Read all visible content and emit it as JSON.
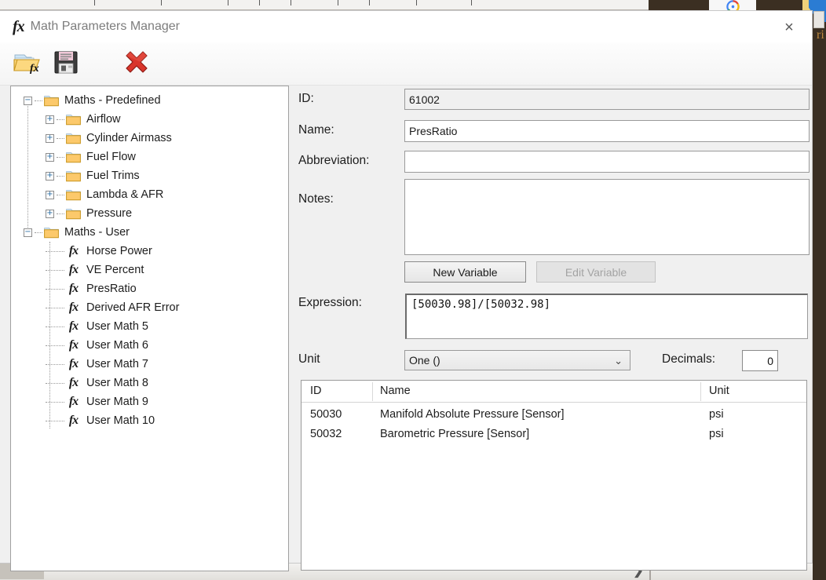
{
  "window": {
    "title": "Math Parameters Manager",
    "fx_icon": "fx-icon",
    "close_icon": "×"
  },
  "toolbar": {
    "buttons": [
      {
        "name": "open-folder-fx-button",
        "icon": "open-folder-fx-icon",
        "label": ""
      },
      {
        "name": "save-button",
        "icon": "floppy-save-icon",
        "label": ""
      },
      {
        "name": "delete-button",
        "icon": "red-x-delete-icon",
        "label": ""
      }
    ]
  },
  "tree": {
    "nodes": [
      {
        "label": "Maths - Predefined",
        "level": 0,
        "type": "folder",
        "expander": "−"
      },
      {
        "label": "Airflow",
        "level": 1,
        "type": "folder",
        "expander": "+"
      },
      {
        "label": "Cylinder Airmass",
        "level": 1,
        "type": "folder",
        "expander": "+"
      },
      {
        "label": "Fuel Flow",
        "level": 1,
        "type": "folder",
        "expander": "+"
      },
      {
        "label": "Fuel Trims",
        "level": 1,
        "type": "folder",
        "expander": "+"
      },
      {
        "label": "Lambda & AFR",
        "level": 1,
        "type": "folder",
        "expander": "+"
      },
      {
        "label": "Pressure",
        "level": 1,
        "type": "folder",
        "expander": "+"
      },
      {
        "label": "Maths - User",
        "level": 0,
        "type": "folder",
        "expander": "−"
      },
      {
        "label": "Horse Power",
        "level": 2,
        "type": "fx",
        "expander": ""
      },
      {
        "label": "VE Percent",
        "level": 2,
        "type": "fx",
        "expander": ""
      },
      {
        "label": "PresRatio",
        "level": 2,
        "type": "fx",
        "expander": ""
      },
      {
        "label": "Derived AFR Error",
        "level": 2,
        "type": "fx",
        "expander": ""
      },
      {
        "label": "User Math 5",
        "level": 2,
        "type": "fx",
        "expander": ""
      },
      {
        "label": "User Math 6",
        "level": 2,
        "type": "fx",
        "expander": ""
      },
      {
        "label": "User Math 7",
        "level": 2,
        "type": "fx",
        "expander": ""
      },
      {
        "label": "User Math 8",
        "level": 2,
        "type": "fx",
        "expander": ""
      },
      {
        "label": "User Math 9",
        "level": 2,
        "type": "fx",
        "expander": ""
      },
      {
        "label": "User Math 10",
        "level": 2,
        "type": "fx",
        "expander": ""
      }
    ]
  },
  "form": {
    "id_label": "ID:",
    "id_value": "61002",
    "name_label": "Name:",
    "name_value": "PresRatio",
    "abbreviation_label": "Abbreviation:",
    "abbreviation_value": "",
    "abbreviation_placeholder": "",
    "notes_label": "Notes:",
    "notes_value": "",
    "notes_placeholder": "",
    "new_variable_button": "New Variable",
    "edit_variable_button": "Edit Variable",
    "expression_label": "Expression:",
    "expression_value": "[50030.98]/[50032.98]",
    "unit_label": "Unit",
    "unit_value": "One ()",
    "unit_chevron": "⌄",
    "decimals_label": "Decimals:",
    "decimals_value": "0"
  },
  "variables_table": {
    "columns": [
      "ID",
      "Name",
      "Unit"
    ],
    "rows": [
      {
        "id": "50030",
        "name": "Manifold Absolute Pressure [Sensor]",
        "unit": "psi"
      },
      {
        "id": "50032",
        "name": "Barometric Pressure [Sensor]",
        "unit": "psi"
      }
    ]
  },
  "background": {
    "right_edge_text": "ri",
    "scroll_arrow": "❯"
  },
  "colors": {
    "dialog_bg": "#ffffff",
    "panel_bg": "#f0f0f0",
    "folder_yellow": "#fcc96b",
    "delete_red": "#c43b30",
    "desktop_brown": "#3a2f23",
    "title_gray": "#7d7d7d"
  }
}
